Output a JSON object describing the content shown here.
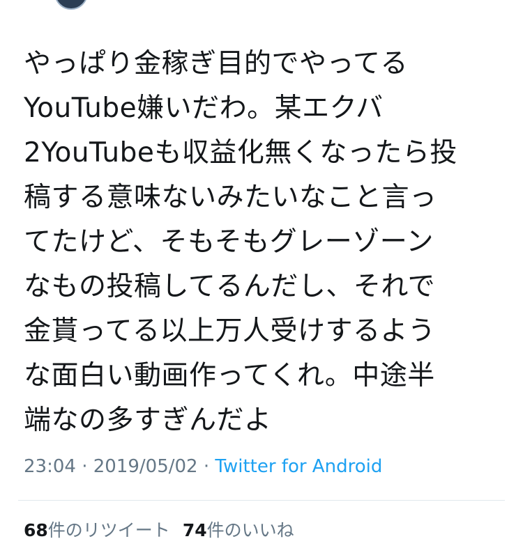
{
  "tweet": {
    "text": "やっぱり金稼ぎ目的でやってる\nYouTube嫌いだわ。某エクバ\n2YouTubeも収益化無くなったら投\n稿する意味ないみたいなこと言っ\nてたけど、そもそもグレーゾーン\nなもの投稿してるんだし、それで\n金貰ってる以上万人受けするよう\nな面白い動画作ってくれ。中途半\n端なの多すぎんだよ",
    "time": "23:04",
    "separator": "·",
    "date": "2019/05/02",
    "source": "Twitter for Android"
  },
  "stats": {
    "retweets_count": "68",
    "retweets_label": "件のリツイート",
    "likes_count": "74",
    "likes_label": "件のいいね"
  }
}
